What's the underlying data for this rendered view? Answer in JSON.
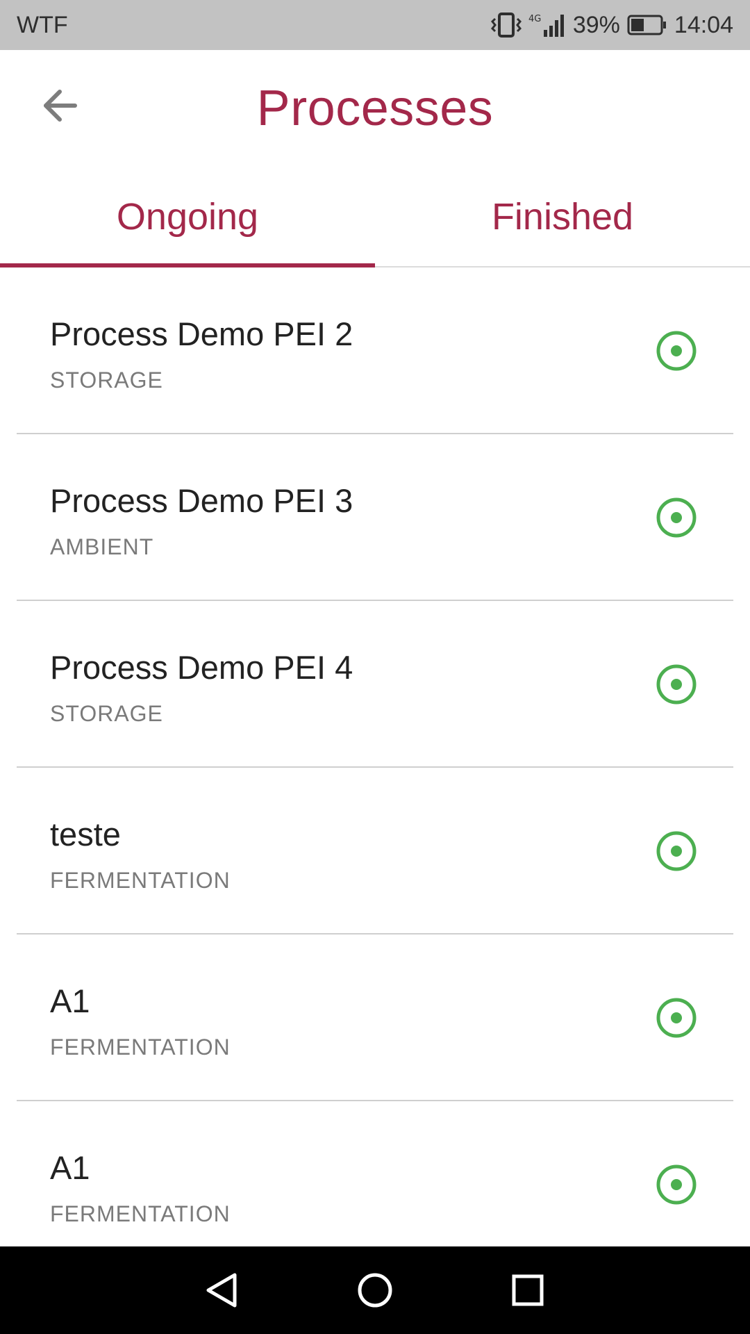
{
  "status_bar": {
    "carrier": "WTF",
    "battery": "39%",
    "time": "14:04"
  },
  "header": {
    "title": "Processes"
  },
  "tabs": [
    {
      "label": "Ongoing",
      "active": true
    },
    {
      "label": "Finished",
      "active": false
    }
  ],
  "processes": [
    {
      "name": "Process Demo PEI 2",
      "type": "STORAGE"
    },
    {
      "name": "Process Demo PEI 3",
      "type": "AMBIENT"
    },
    {
      "name": "Process Demo PEI 4",
      "type": "STORAGE"
    },
    {
      "name": "teste",
      "type": "FERMENTATION"
    },
    {
      "name": "A1",
      "type": "FERMENTATION"
    },
    {
      "name": "A1",
      "type": "FERMENTATION"
    }
  ],
  "colors": {
    "accent": "#a3284a",
    "status_active": "#4caf50",
    "status_bar_bg": "#c2c2c2",
    "nav_bar_bg": "#000000"
  },
  "icons": {
    "back": "arrow-left-icon",
    "status": "radio-active-icon",
    "nav_back": "triangle-back-icon",
    "nav_home": "circle-home-icon",
    "nav_recents": "square-recents-icon"
  }
}
